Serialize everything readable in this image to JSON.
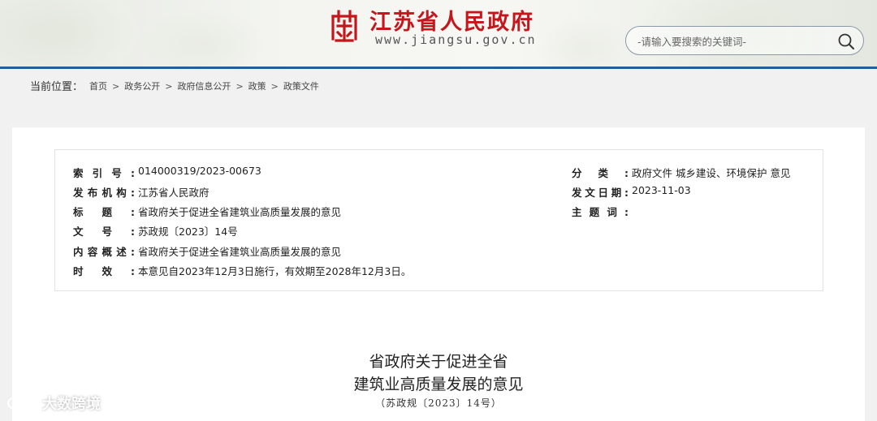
{
  "header": {
    "site_name": "江苏省人民政府",
    "site_url": "www.jiangsu.gov.cn",
    "logo_icon": "jiangsu-emblem-icon",
    "brand_color": "#c4161c",
    "accent_color": "#1f5fa0"
  },
  "search": {
    "placeholder": "-请输入要搜索的关键词-",
    "icon": "search-icon"
  },
  "breadcrumb": {
    "label": "当前位置：",
    "items": [
      "首页",
      "政务公开",
      "政府信息公开",
      "政策",
      "政策文件"
    ]
  },
  "meta": {
    "index_no_key": "索引号:",
    "index_no": "014000319/2023-00673",
    "publisher_key": "发布机构:",
    "publisher": "江苏省人民政府",
    "title_key": "标题:",
    "title": "省政府关于促进全省建筑业高质量发展的意见",
    "doc_no_key": "文号:",
    "doc_no": "苏政规〔2023〕14号",
    "summary_key": "内容概述:",
    "summary": "省政府关于促进全省建筑业高质量发展的意见",
    "validity_key": "时效:",
    "validity": "本意见自2023年12月3日施行，有效期至2028年12月3日。",
    "category_key": "分类:",
    "category": "政府文件 城乡建设、环境保护 意见",
    "date_key": "发文日期:",
    "date": "2023-11-03",
    "keywords_key": "主题词:",
    "keywords": ""
  },
  "document": {
    "title_line1": "省政府关于促进全省",
    "title_line2": "建筑业高质量发展的意见",
    "doc_number": "（苏政规〔2023〕14号）"
  },
  "watermark": {
    "text": "大数跨境"
  }
}
